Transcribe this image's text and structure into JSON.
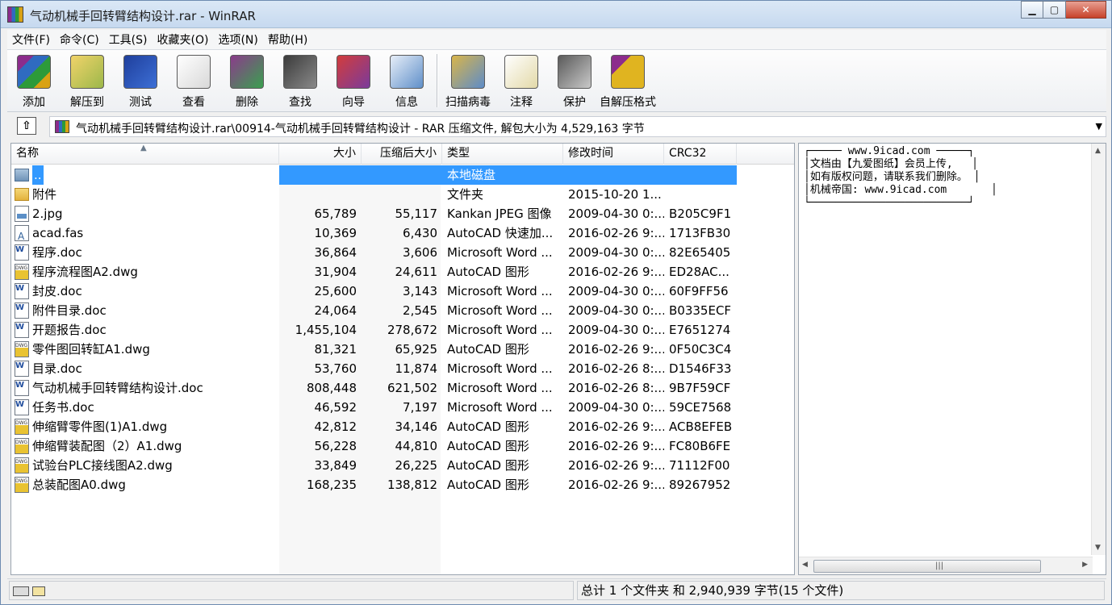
{
  "window": {
    "title": "气动机械手回转臂结构设计.rar - WinRAR"
  },
  "menu": [
    "文件(F)",
    "命令(C)",
    "工具(S)",
    "收藏夹(O)",
    "选项(N)",
    "帮助(H)"
  ],
  "toolbar": {
    "group1": [
      {
        "label": "添加",
        "icon": "add-archive-icon"
      },
      {
        "label": "解压到",
        "icon": "extract-icon"
      },
      {
        "label": "测试",
        "icon": "test-icon"
      },
      {
        "label": "查看",
        "icon": "view-icon"
      },
      {
        "label": "删除",
        "icon": "delete-icon"
      },
      {
        "label": "查找",
        "icon": "find-icon"
      },
      {
        "label": "向导",
        "icon": "wizard-icon"
      },
      {
        "label": "信息",
        "icon": "info-icon"
      }
    ],
    "group2": [
      {
        "label": "扫描病毒",
        "icon": "virus-scan-icon"
      },
      {
        "label": "注释",
        "icon": "comment-icon"
      },
      {
        "label": "保护",
        "icon": "protect-icon"
      },
      {
        "label": "自解压格式",
        "icon": "sfx-icon"
      }
    ]
  },
  "address": {
    "path": "气动机械手回转臂结构设计.rar\\00914-气动机械手回转臂结构设计 - RAR 压缩文件, 解包大小为 4,529,163 字节"
  },
  "columns": {
    "name": "名称",
    "size": "大小",
    "packed": "压缩后大小",
    "type": "类型",
    "modified": "修改时间",
    "crc": "CRC32"
  },
  "files": [
    {
      "name": "..",
      "size": "",
      "packed": "",
      "type": "本地磁盘",
      "modified": "",
      "crc": "",
      "icon": "folder-up-icon",
      "selected": true
    },
    {
      "name": "附件",
      "size": "",
      "packed": "",
      "type": "文件夹",
      "modified": "2015-10-20 1...",
      "crc": "",
      "icon": "folder-icon"
    },
    {
      "name": "2.jpg",
      "size": "65,789",
      "packed": "55,117",
      "type": "Kankan JPEG 图像",
      "modified": "2009-04-30 0:...",
      "crc": "B205C9F1",
      "icon": "jpg-icon"
    },
    {
      "name": "acad.fas",
      "size": "10,369",
      "packed": "6,430",
      "type": "AutoCAD 快速加...",
      "modified": "2016-02-26 9:...",
      "crc": "1713FB30",
      "icon": "fas-icon"
    },
    {
      "name": "程序.doc",
      "size": "36,864",
      "packed": "3,606",
      "type": "Microsoft Word ...",
      "modified": "2009-04-30 0:...",
      "crc": "82E65405",
      "icon": "doc-icon"
    },
    {
      "name": "程序流程图A2.dwg",
      "size": "31,904",
      "packed": "24,611",
      "type": "AutoCAD 图形",
      "modified": "2016-02-26 9:...",
      "crc": "ED28AC...",
      "icon": "dwg-icon"
    },
    {
      "name": "封皮.doc",
      "size": "25,600",
      "packed": "3,143",
      "type": "Microsoft Word ...",
      "modified": "2009-04-30 0:...",
      "crc": "60F9FF56",
      "icon": "doc-icon"
    },
    {
      "name": "附件目录.doc",
      "size": "24,064",
      "packed": "2,545",
      "type": "Microsoft Word ...",
      "modified": "2009-04-30 0:...",
      "crc": "B0335ECF",
      "icon": "doc-icon"
    },
    {
      "name": "开题报告.doc",
      "size": "1,455,104",
      "packed": "278,672",
      "type": "Microsoft Word ...",
      "modified": "2009-04-30 0:...",
      "crc": "E7651274",
      "icon": "doc-icon"
    },
    {
      "name": "零件图回转缸A1.dwg",
      "size": "81,321",
      "packed": "65,925",
      "type": "AutoCAD 图形",
      "modified": "2016-02-26 9:...",
      "crc": "0F50C3C4",
      "icon": "dwg-icon"
    },
    {
      "name": "目录.doc",
      "size": "53,760",
      "packed": "11,874",
      "type": "Microsoft Word ...",
      "modified": "2016-02-26 8:...",
      "crc": "D1546F33",
      "icon": "doc-icon"
    },
    {
      "name": "气动机械手回转臂结构设计.doc",
      "size": "808,448",
      "packed": "621,502",
      "type": "Microsoft Word ...",
      "modified": "2016-02-26 8:...",
      "crc": "9B7F59CF",
      "icon": "doc-icon"
    },
    {
      "name": "任务书.doc",
      "size": "46,592",
      "packed": "7,197",
      "type": "Microsoft Word ...",
      "modified": "2009-04-30 0:...",
      "crc": "59CE7568",
      "icon": "doc-icon"
    },
    {
      "name": "伸缩臂零件图(1)A1.dwg",
      "size": "42,812",
      "packed": "34,146",
      "type": "AutoCAD 图形",
      "modified": "2016-02-26 9:...",
      "crc": "ACB8EFEB",
      "icon": "dwg-icon"
    },
    {
      "name": "伸缩臂装配图（2）A1.dwg",
      "size": "56,228",
      "packed": "44,810",
      "type": "AutoCAD 图形",
      "modified": "2016-02-26 9:...",
      "crc": "FC80B6FE",
      "icon": "dwg-icon"
    },
    {
      "name": "试验台PLC接线图A2.dwg",
      "size": "33,849",
      "packed": "26,225",
      "type": "AutoCAD 图形",
      "modified": "2016-02-26 9:...",
      "crc": "71112F00",
      "icon": "dwg-icon"
    },
    {
      "name": "总装配图A0.dwg",
      "size": "168,235",
      "packed": "138,812",
      "type": "AutoCAD 图形",
      "modified": "2016-02-26 9:...",
      "crc": "89267952",
      "icon": "dwg-icon"
    }
  ],
  "info_panel": {
    "lines": [
      "┌───── www.9icad.com ─────┐",
      "│文档由【九爱图纸】会员上传,   │",
      "│如有版权问题，请联系我们删除。 │",
      "│机械帝国: www.9icad.com       │",
      "└─────────────────────────┘"
    ]
  },
  "status": {
    "summary": "总计 1 个文件夹 和 2,940,939 字节(15 个文件)"
  },
  "colors": {
    "selection": "#3399ff",
    "title_bg": "#c6d9ef",
    "close_button": "#c7422a"
  }
}
